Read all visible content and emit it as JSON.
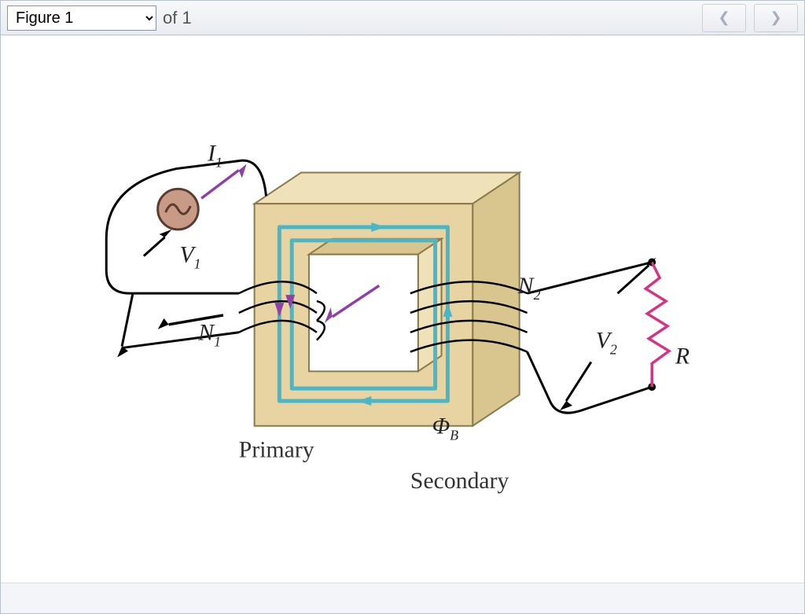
{
  "toolbar": {
    "figure_selected": "Figure 1",
    "of_label": "of 1",
    "prev_glyph": "❮",
    "next_glyph": "❯"
  },
  "labels": {
    "I1_base": "I",
    "I1_sub": "1",
    "V1_base": "V",
    "V1_sub": "1",
    "N1_base": "N",
    "N1_sub": "1",
    "N2_base": "N",
    "N2_sub": "2",
    "V2_base": "V",
    "V2_sub": "2",
    "R": "R",
    "PhiB_base": "Φ",
    "PhiB_sub": "B",
    "primary": "Primary",
    "secondary": "Secondary"
  }
}
